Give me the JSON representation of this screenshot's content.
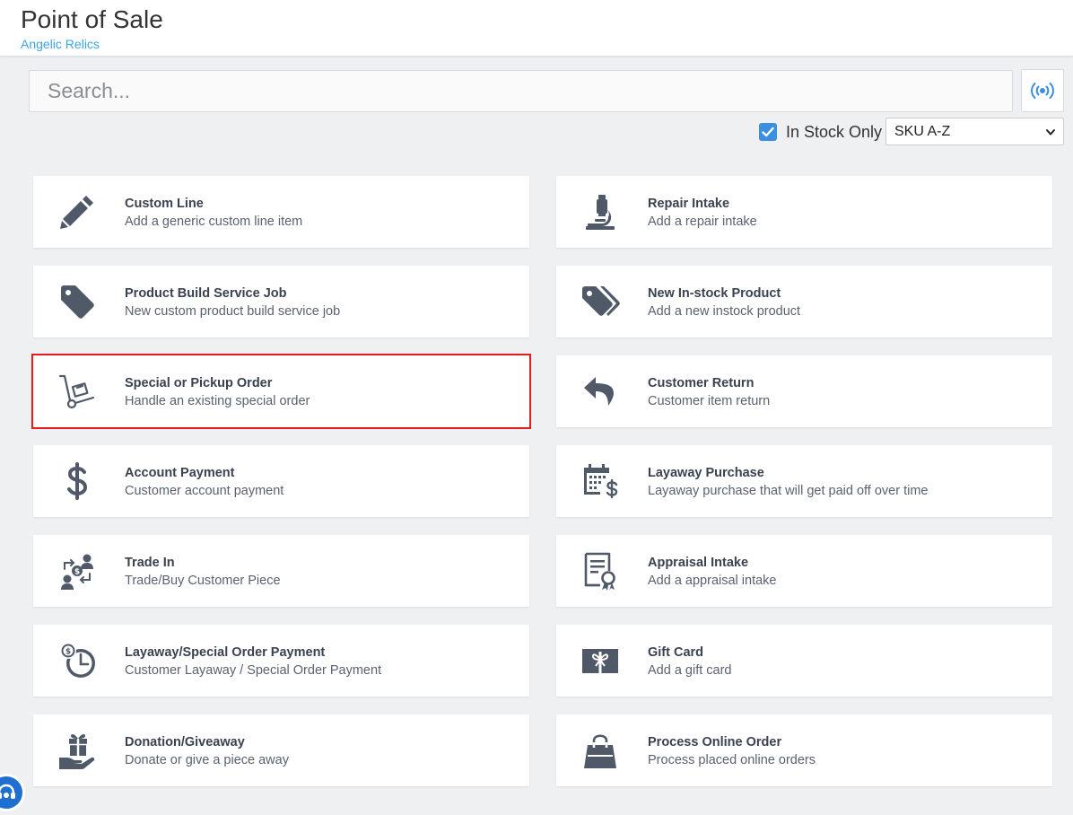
{
  "header": {
    "title": "Point of Sale",
    "subtitle": "Angelic Relics"
  },
  "search": {
    "placeholder": "Search...",
    "value": ""
  },
  "scan_button": {
    "icon": "broadcast-icon"
  },
  "filters": {
    "in_stock_only_label": "In Stock Only",
    "in_stock_only_checked": true,
    "sort_selected": "SKU A-Z"
  },
  "colors": {
    "accent": "#3b8fe0",
    "subtitle": "#3ba3e6",
    "selected_border": "#e11d1d",
    "icon": "#4f5968"
  },
  "actions": [
    {
      "title": "Custom Line",
      "desc": "Add a generic custom line item",
      "icon": "pencil-icon"
    },
    {
      "title": "Repair Intake",
      "desc": "Add a repair intake",
      "icon": "microscope-icon"
    },
    {
      "title": "Product Build Service Job",
      "desc": "New custom product build service job",
      "icon": "tag-icon"
    },
    {
      "title": "New In-stock Product",
      "desc": "Add a new instock product",
      "icon": "tags-icon"
    },
    {
      "title": "Special or Pickup Order",
      "desc": "Handle an existing special order",
      "icon": "dolly-icon",
      "selected": true
    },
    {
      "title": "Customer Return",
      "desc": "Customer item return",
      "icon": "reply-icon"
    },
    {
      "title": "Account Payment",
      "desc": "Customer account payment",
      "icon": "dollar-icon"
    },
    {
      "title": "Layaway Purchase",
      "desc": "Layaway purchase that will get paid off over time",
      "icon": "calendar-dollar-icon"
    },
    {
      "title": "Trade In",
      "desc": "Trade/Buy Customer Piece",
      "icon": "trade-exchange-icon"
    },
    {
      "title": "Appraisal Intake",
      "desc": "Add a appraisal intake",
      "icon": "certificate-icon"
    },
    {
      "title": "Layaway/Special Order Payment",
      "desc": "Customer Layaway / Special Order Payment",
      "icon": "clock-dollar-icon"
    },
    {
      "title": "Gift Card",
      "desc": "Add a gift card",
      "icon": "gift-card-icon"
    },
    {
      "title": "Donation/Giveaway",
      "desc": "Donate or give a piece away",
      "icon": "hand-gift-icon"
    },
    {
      "title": "Process Online Order",
      "desc": "Process placed online orders",
      "icon": "shopping-bag-icon"
    }
  ],
  "help_button": {
    "icon": "support-icon"
  }
}
